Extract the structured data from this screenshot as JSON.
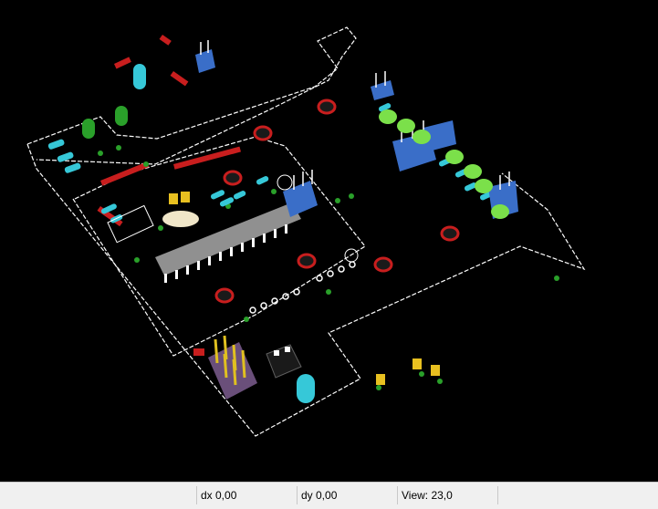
{
  "statusbar": {
    "field1": "",
    "dx": "dx 0,00",
    "dy": "dy 0,00",
    "view": "View: 23,0",
    "field5": ""
  },
  "colors": {
    "background": "#000000",
    "outline": "#ffffff",
    "pad": "#c81e1e",
    "component_cyan": "#36c8d8",
    "component_green": "#2aa02a",
    "led_lime": "#7be04a",
    "connector_blue": "#3a6ec8",
    "ic_body": "#909090",
    "header_gold": "#e0c020",
    "header_body": "#6a4f7a",
    "regulator": "#1a1a1a",
    "crystal": "#f0e6c8",
    "cap_yellow": "#e8c020"
  },
  "icons": [
    "3d-pcb-view"
  ]
}
